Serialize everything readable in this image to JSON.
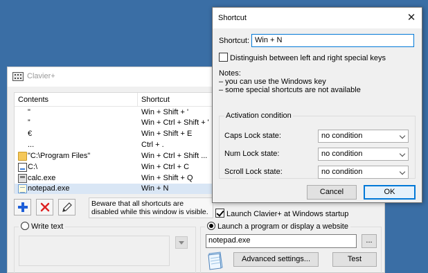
{
  "main_window": {
    "title": "Clavier+",
    "columns": {
      "contents": "Contents",
      "shortcut": "Shortcut"
    },
    "rows": [
      {
        "icon": "none",
        "content": "\"",
        "shortcut": "Win + Shift + '"
      },
      {
        "icon": "none",
        "content": "”",
        "shortcut": "Win + Ctrl + Shift + '"
      },
      {
        "icon": "none",
        "content": "€",
        "shortcut": "Win + Shift + E"
      },
      {
        "icon": "none",
        "content": "...",
        "shortcut": "Ctrl + ."
      },
      {
        "icon": "folder-icon",
        "content": "\"C:\\Program Files\"",
        "shortcut": "Win + Ctrl + Shift ..."
      },
      {
        "icon": "drive-icon",
        "content": "C:\\",
        "shortcut": "Win + Ctrl + C"
      },
      {
        "icon": "calculator-icon",
        "content": "calc.exe",
        "shortcut": "Win + Shift + Q"
      },
      {
        "icon": "notepad-icon",
        "content": "notepad.exe",
        "shortcut": "Win + N",
        "selected": true
      }
    ],
    "warning": "Beware that all shortcuts are disabled while this window is visible.",
    "launch_startup": {
      "label": "Launch Clavier+ at Windows startup",
      "checked": true
    },
    "write_text": {
      "label": "Write text",
      "selected": false
    },
    "launch_program": {
      "label": "Launch a program or display a website",
      "selected": true,
      "value": "notepad.exe"
    },
    "browse_label": "...",
    "advanced_label": "Advanced settings...",
    "test_label": "Test"
  },
  "dialog": {
    "title": "Shortcut",
    "close_label": "✕",
    "shortcut_label": "Shortcut:",
    "shortcut_value": "Win + N",
    "distinguish_label": "Distinguish between left and right special keys",
    "notes": {
      "title": "Notes:",
      "line1": "– you can use the Windows key",
      "line2": "– some special shortcuts are not available"
    },
    "activation": {
      "title": "Activation condition",
      "caps": {
        "label": "Caps Lock state:",
        "value": "no condition"
      },
      "num": {
        "label": "Num Lock state:",
        "value": "no condition"
      },
      "scroll": {
        "label": "Scroll Lock state:",
        "value": "no condition"
      }
    },
    "cancel_label": "Cancel",
    "ok_label": "OK"
  },
  "colors": {
    "desktop": "#3a6ea5",
    "accent": "#0078d7",
    "selected_row": "#d9e6f5"
  }
}
